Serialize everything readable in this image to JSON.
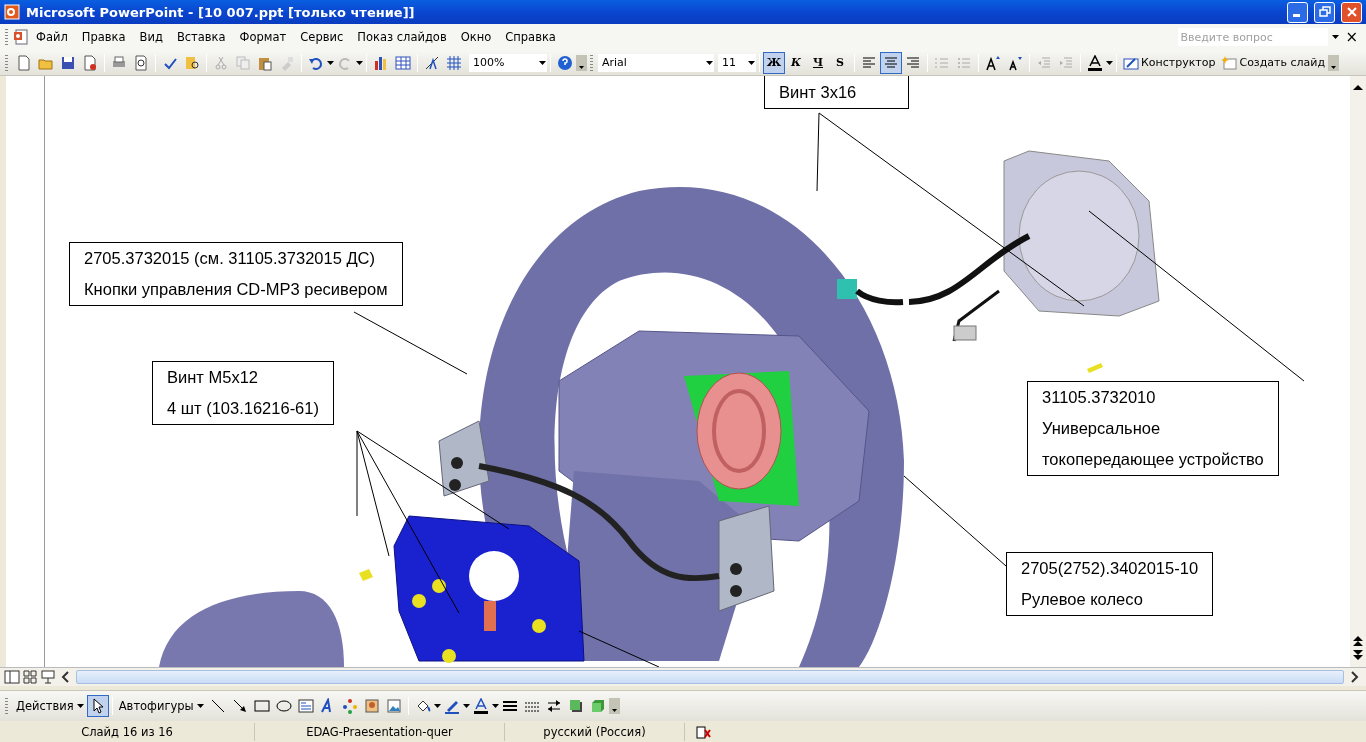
{
  "window": {
    "title": "Microsoft PowerPoint - [10 007.ppt [только чтение]]"
  },
  "menu": {
    "items": [
      "Файл",
      "Правка",
      "Вид",
      "Вставка",
      "Формат",
      "Сервис",
      "Показ слайдов",
      "Окно",
      "Справка"
    ],
    "help_field": {
      "placeholder": "Введите вопрос"
    },
    "close_glyph": "×"
  },
  "standard_toolbar": {
    "zoom": "100%"
  },
  "formatting_toolbar": {
    "font": "Arial",
    "size": "11",
    "style_buttons": [
      {
        "label": "Ж",
        "selected": true
      },
      {
        "label": "К",
        "selected": false
      },
      {
        "label": "Ч",
        "selected": false
      },
      {
        "label": "S",
        "selected": false
      }
    ],
    "align_buttons": [
      {
        "selected": false
      },
      {
        "selected": true
      },
      {
        "selected": false
      }
    ],
    "design_button": "Конструктор",
    "new_slide_button": "Создать слайд"
  },
  "slide": {
    "callouts": [
      {
        "lines": [
          "Винт 3x16"
        ]
      },
      {
        "lines": [
          "2705.3732015 (см. 31105.3732015 ДС)",
          "Кнопки управления CD-MP3 ресивером"
        ]
      },
      {
        "lines": [
          "Винт М5x12",
          "4 шт (103.16216-61)"
        ]
      },
      {
        "lines": [
          "31105.3732010",
          "Универсальное",
          "токопередающее устройство"
        ]
      },
      {
        "lines": [
          "2705(2752).3402015-10",
          "Рулевое колесо"
        ]
      }
    ]
  },
  "drawing_toolbar": {
    "actions": "Действия",
    "pointer": {
      "selected": true
    },
    "autoshapes": "Автофигуры"
  },
  "status_bar": [
    "Слайд 16 из 16",
    "EDAG-Praesentation-quer",
    "русский (Россия)"
  ]
}
